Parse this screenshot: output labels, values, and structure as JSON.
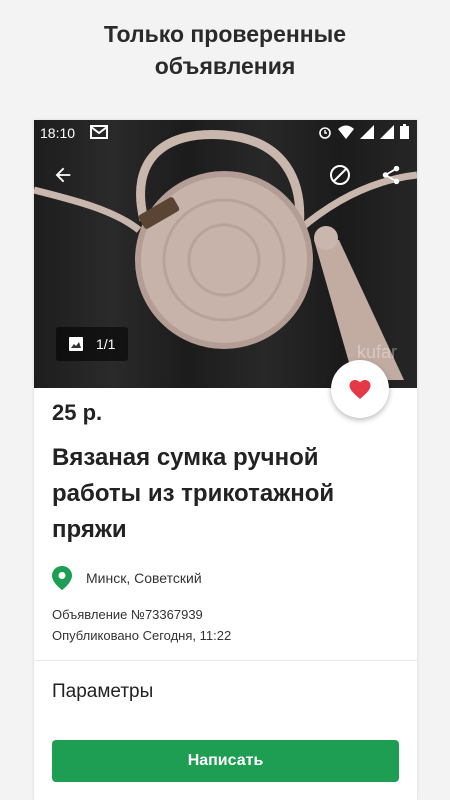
{
  "promo": {
    "headline": "Только проверенные\nобъявления"
  },
  "status_bar": {
    "time": "18:10"
  },
  "gallery": {
    "counter": "1/1",
    "watermark": "kufar"
  },
  "listing": {
    "price": "25 р.",
    "title": "Вязаная сумка ручной работы из трикотажной пряжи",
    "location": "Минск, Советский",
    "ad_number": "Объявление №73367939",
    "published": "Опубликовано Сегодня, 11:22"
  },
  "sections": {
    "parameters": "Параметры"
  },
  "actions": {
    "write_label": "Написать"
  },
  "colors": {
    "accent": "#1e9e52",
    "favorite": "#e53946",
    "pin": "#1e9e52",
    "photo_bg": "#222222"
  },
  "icons": [
    "back-arrow-icon",
    "block-icon",
    "share-icon",
    "image-icon",
    "heart-icon",
    "location-pin-icon"
  ]
}
